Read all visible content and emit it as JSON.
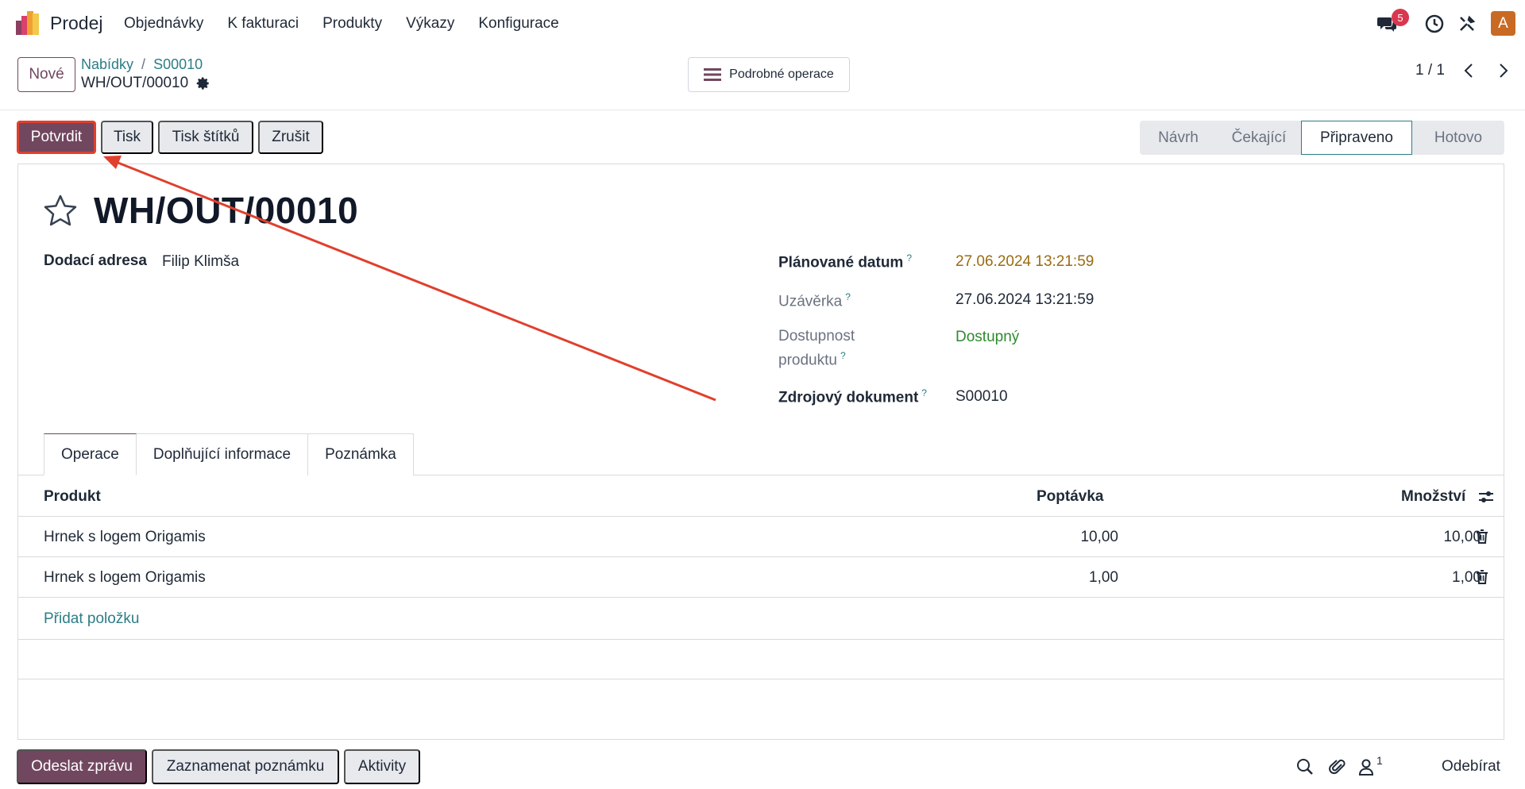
{
  "navbar": {
    "app_name": "Prodej",
    "menu": [
      "Objednávky",
      "K fakturaci",
      "Produkty",
      "Výkazy",
      "Konfigurace"
    ],
    "chat_badge": "5",
    "avatar_letter": "A",
    "icons": [
      "messages-icon",
      "clock-icon",
      "tools-icon"
    ]
  },
  "control": {
    "new_label": "Nové",
    "breadcrumb": [
      "Nabídky",
      "S00010"
    ],
    "breadcrumb_sep": "/",
    "record_name": "WH/OUT/00010",
    "detailed_ops_label": "Podrobné operace",
    "pager": "1 / 1"
  },
  "actions": {
    "confirm": "Potvrdit",
    "print": "Tisk",
    "print_labels": "Tisk štítků",
    "cancel": "Zrušit"
  },
  "statusbar": {
    "stages": [
      "Návrh",
      "Čekající",
      "Připraveno",
      "Hotovo"
    ],
    "current": "Připraveno"
  },
  "form": {
    "title": "WH/OUT/00010",
    "delivery_address_label": "Dodací adresa",
    "delivery_address_value": "Filip Klimša",
    "scheduled_date_label": "Plánované datum",
    "scheduled_date_value": "27.06.2024 13:21:59",
    "deadline_label": "Uzávěrka",
    "deadline_value": "27.06.2024 13:21:59",
    "availability_label_1": "Dostupnost",
    "availability_label_2": "produktu",
    "availability_value": "Dostupný",
    "source_doc_label": "Zdrojový dokument",
    "source_doc_value": "S00010",
    "help_mark": "?"
  },
  "tabs": [
    "Operace",
    "Doplňující informace",
    "Poznámka"
  ],
  "table": {
    "headers": {
      "product": "Produkt",
      "demand": "Poptávka",
      "quantity": "Množství"
    },
    "rows": [
      {
        "product": "Hrnek s logem Origamis",
        "demand": "10,00",
        "quantity": "10,00"
      },
      {
        "product": "Hrnek s logem Origamis",
        "demand": "1,00",
        "quantity": "1,00"
      }
    ],
    "add_line": "Přidat položku"
  },
  "chatter": {
    "send_message": "Odeslat zprávu",
    "log_note": "Zaznamenat poznámku",
    "activities": "Aktivity",
    "followers_count": "1",
    "follow": "Odebírat"
  },
  "colors": {
    "brand": "#71475f",
    "link": "#2d7d86",
    "highlight": "#e0402d",
    "warning": "#9a6b12",
    "success": "#2f8a2f"
  }
}
